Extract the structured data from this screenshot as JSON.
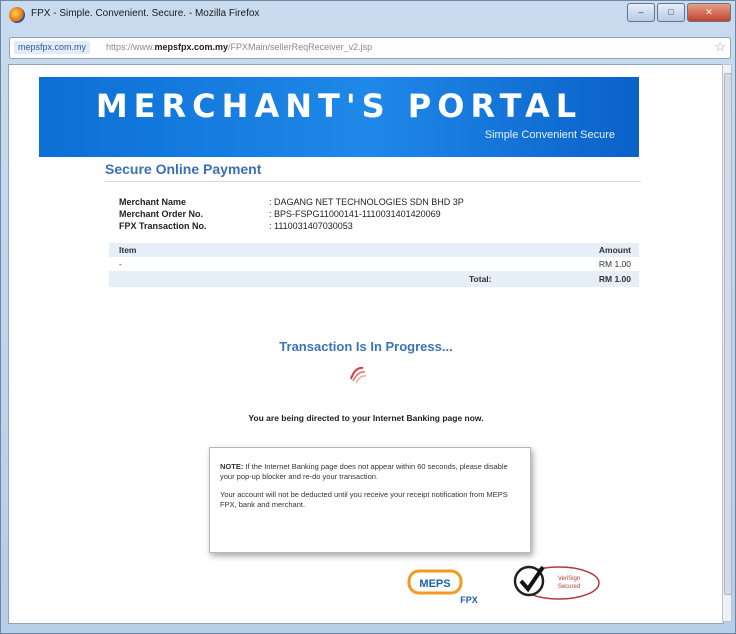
{
  "browser": {
    "title": "FPX - Simple. Convenient. Secure. - Mozilla Firefox",
    "site_identity": "mepsfpx.com.my",
    "url_prefix": "https://www.",
    "url_domain": "mepsfpx.com.my",
    "url_path": "/FPXMain/sellerReqReceiver_v2.jsp",
    "colors": {
      "frame": "#c9dbee",
      "close_button": "#c2422a"
    }
  },
  "banner": {
    "title": "MERCHANT'S PORTAL",
    "tagline": "Simple  Convenient  Secure",
    "color": "#1f88e8"
  },
  "payment": {
    "section_title": "Secure Online Payment",
    "fields": [
      {
        "label": "Merchant Name",
        "value": ": DAGANG NET TECHNOLOGIES SDN BHD 3P"
      },
      {
        "label": "Merchant Order No.",
        "value": ": BPS-FSPG11000141-1110031401420069"
      },
      {
        "label": "FPX Transaction No.",
        "value": ": 1110031407030053"
      }
    ],
    "table": {
      "headers": [
        "Item",
        "Amount"
      ],
      "rows": [
        {
          "item": "-",
          "amount": "RM 1.00"
        }
      ],
      "total_label": "Total:",
      "total_value": "RM 1.00"
    }
  },
  "status": {
    "progress_text": "Transaction Is In Progress...",
    "redirect_text": "You are being directed to your Internet Banking page now."
  },
  "note": {
    "label": "NOTE:",
    "line1": " If the Internet Banking page does not appear within 60 seconds, please disable your pop-up blocker and re-do your transaction.",
    "line2": "Your account will not be deducted until you receive your receipt notification from MEPS FPX, bank and merchant."
  },
  "logos": {
    "meps": "MEPS",
    "fpx": "FPX",
    "verisign_line1": "VeriSign",
    "verisign_line2": "Secured"
  }
}
